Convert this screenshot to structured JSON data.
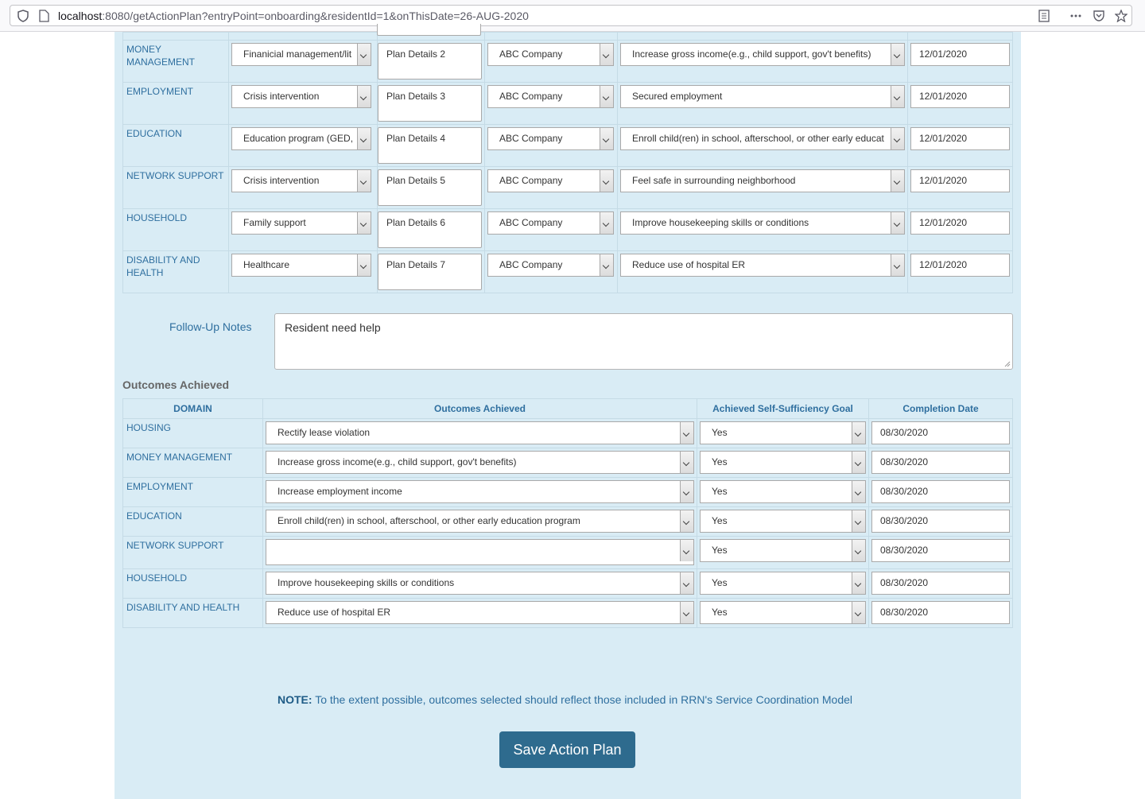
{
  "browser": {
    "url_host": "localhost",
    "url_rest": ":8080/getActionPlan?entryPoint=onboarding&residentId=1&onThisDate=26-AUG-2020"
  },
  "plan_rows": [
    {
      "domain": "MONEY MANAGEMENT",
      "service": "Finanicial management/lit",
      "details": "Plan Details 2",
      "provider": "ABC Company",
      "outcome": "Increase gross income(e.g., child support, gov't benefits)",
      "date": "12/01/2020"
    },
    {
      "domain": "EMPLOYMENT",
      "service": "Crisis intervention",
      "details": "Plan Details 3",
      "provider": "ABC Company",
      "outcome": "Secured employment",
      "date": "12/01/2020"
    },
    {
      "domain": "EDUCATION",
      "service": "Education program (GED,",
      "details": "Plan Details 4",
      "provider": "ABC Company",
      "outcome": "Enroll child(ren) in school, afterschool, or other early educat",
      "date": "12/01/2020"
    },
    {
      "domain": "NETWORK SUPPORT",
      "service": "Crisis intervention",
      "details": "Plan Details 5",
      "provider": "ABC Company",
      "outcome": "Feel safe in surrounding neighborhood",
      "date": "12/01/2020"
    },
    {
      "domain": "HOUSEHOLD",
      "service": "Family support",
      "details": "Plan Details 6",
      "provider": "ABC Company",
      "outcome": "Improve housekeeping skills or conditions",
      "date": "12/01/2020"
    },
    {
      "domain": "DISABILITY AND HEALTH",
      "service": "Healthcare",
      "details": "Plan Details 7",
      "provider": "ABC Company",
      "outcome": "Reduce use of hospital ER",
      "date": "12/01/2020"
    }
  ],
  "followup": {
    "label": "Follow-Up Notes",
    "value": "Resident need help"
  },
  "outcomes": {
    "heading": "Outcomes Achieved",
    "columns": [
      "DOMAIN",
      "Outcomes Achieved",
      "Achieved Self-Sufficiency Goal",
      "Completion Date"
    ],
    "rows": [
      {
        "domain": "HOUSING",
        "outcome": "Rectify lease violation",
        "goal": "Yes",
        "date": "08/30/2020"
      },
      {
        "domain": "MONEY MANAGEMENT",
        "outcome": "Increase gross income(e.g., child support, gov't benefits)",
        "goal": "Yes",
        "date": "08/30/2020"
      },
      {
        "domain": "EMPLOYMENT",
        "outcome": "Increase employment income",
        "goal": "Yes",
        "date": "08/30/2020"
      },
      {
        "domain": "EDUCATION",
        "outcome": "Enroll child(ren) in school, afterschool, or other early education program",
        "goal": "Yes",
        "date": "08/30/2020"
      },
      {
        "domain": "NETWORK SUPPORT",
        "outcome": "",
        "goal": "Yes",
        "date": "08/30/2020"
      },
      {
        "domain": "HOUSEHOLD",
        "outcome": "Improve housekeeping skills or conditions",
        "goal": "Yes",
        "date": "08/30/2020"
      },
      {
        "domain": "DISABILITY AND HEALTH",
        "outcome": "Reduce use of hospital ER",
        "goal": "Yes",
        "date": "08/30/2020"
      }
    ]
  },
  "note": {
    "prefix": "NOTE:",
    "text": " To the extent possible, outcomes selected should reflect those included in RRN's Service Coordination Model"
  },
  "save_button": "Save Action Plan"
}
